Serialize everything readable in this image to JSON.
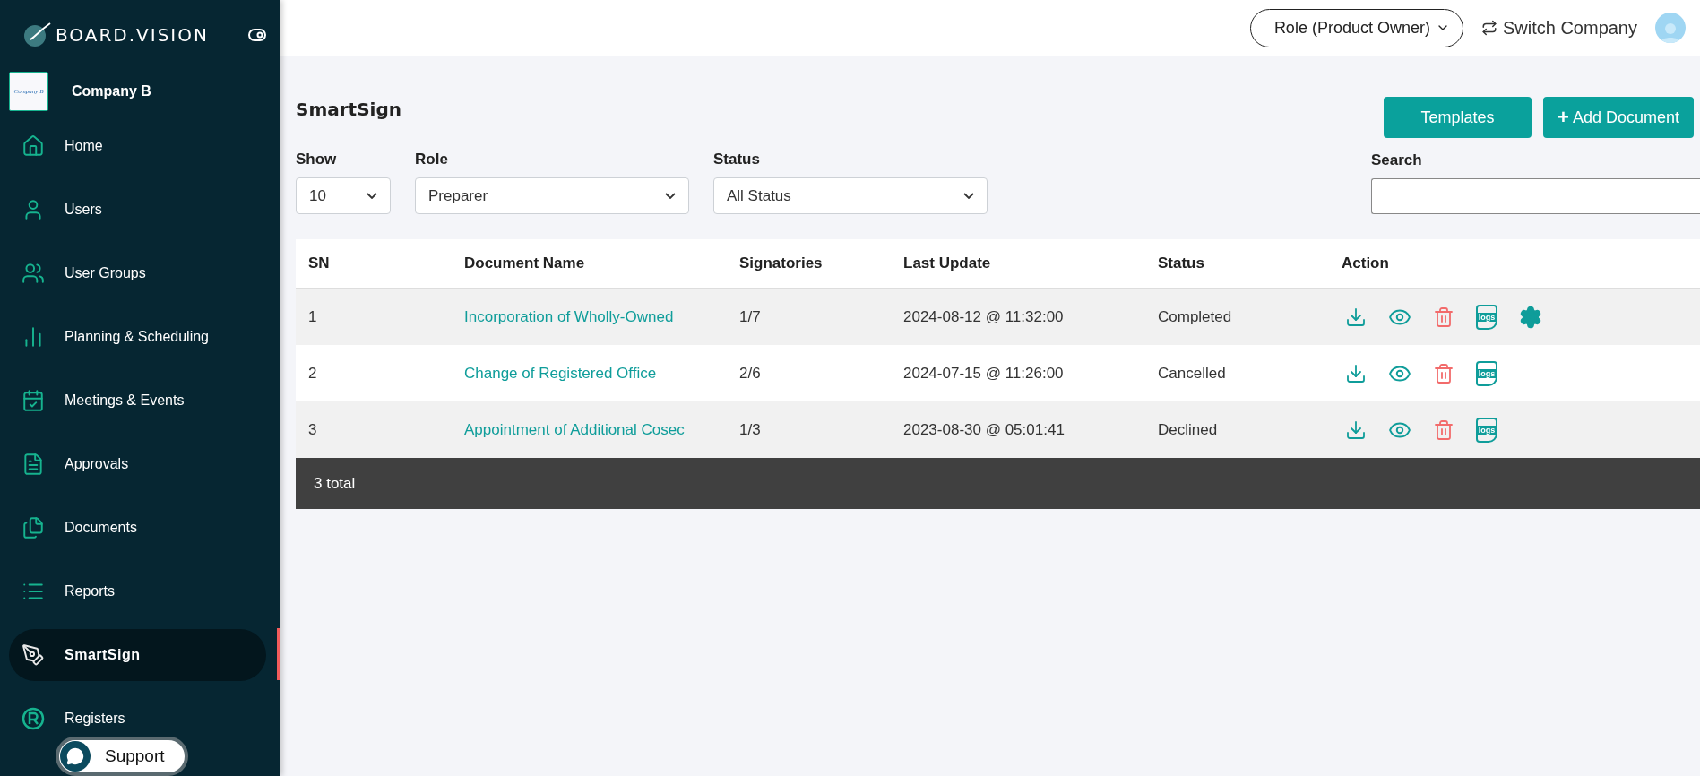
{
  "brand": {
    "name": "BOARD.VISION"
  },
  "company": {
    "name": "Company B",
    "logo_text": "Company B"
  },
  "sidebar": {
    "items": [
      {
        "label": "Home",
        "kind": "home",
        "selected": false
      },
      {
        "label": "Users",
        "kind": "user",
        "selected": false
      },
      {
        "label": "User Groups",
        "kind": "users",
        "selected": false
      },
      {
        "label": "Planning & Scheduling",
        "kind": "bars",
        "selected": false
      },
      {
        "label": "Meetings & Events",
        "kind": "calendar",
        "selected": false
      },
      {
        "label": "Approvals",
        "kind": "note",
        "selected": false
      },
      {
        "label": "Documents",
        "kind": "docs",
        "selected": false
      },
      {
        "label": "Reports",
        "kind": "list",
        "selected": false
      },
      {
        "label": "SmartSign",
        "kind": "pen",
        "selected": true
      },
      {
        "label": "Registers",
        "kind": "registered",
        "selected": false
      }
    ]
  },
  "support": {
    "label": "Support"
  },
  "header": {
    "role": "Role (Product Owner)",
    "switch": "Switch Company"
  },
  "page": {
    "title": "SmartSign",
    "buttons": [
      {
        "label": "Templates",
        "kind": "plain"
      },
      {
        "label": "Add Document",
        "kind": "add",
        "icon_text": "+"
      }
    ]
  },
  "filters": [
    {
      "label": "Show",
      "value": "10"
    },
    {
      "label": "Role",
      "value": "Preparer"
    },
    {
      "label": "Status",
      "value": "All Status"
    }
  ],
  "search": {
    "label": "Search"
  },
  "table": {
    "columns": [
      "SN",
      "Document Name",
      "Signatories",
      "Last Update",
      "Status",
      "Action"
    ],
    "rows": [
      {
        "sn": "1",
        "name": "Incorporation of Wholly-Owned",
        "signatories": "1/7",
        "updated": "2024-08-12 @ 11:32:00",
        "status": "Completed",
        "actions": [
          {
            "kind": "download"
          },
          {
            "kind": "view"
          },
          {
            "kind": "delete"
          },
          {
            "kind": "logs",
            "label": "logs"
          },
          {
            "kind": "settings"
          }
        ]
      },
      {
        "sn": "2",
        "name": "Change of Registered Office",
        "signatories": "2/6",
        "updated": "2024-07-15 @ 11:26:00",
        "status": "Cancelled",
        "actions": [
          {
            "kind": "download"
          },
          {
            "kind": "view"
          },
          {
            "kind": "delete"
          },
          {
            "kind": "logs",
            "label": "logs"
          }
        ]
      },
      {
        "sn": "3",
        "name": "Appointment of Additional Cosec",
        "signatories": "1/3",
        "updated": "2023-08-30 @ 05:01:41",
        "status": "Declined",
        "actions": [
          {
            "kind": "download"
          },
          {
            "kind": "view"
          },
          {
            "kind": "delete"
          },
          {
            "kind": "logs",
            "label": "logs"
          }
        ]
      }
    ],
    "footer": "3 total"
  }
}
